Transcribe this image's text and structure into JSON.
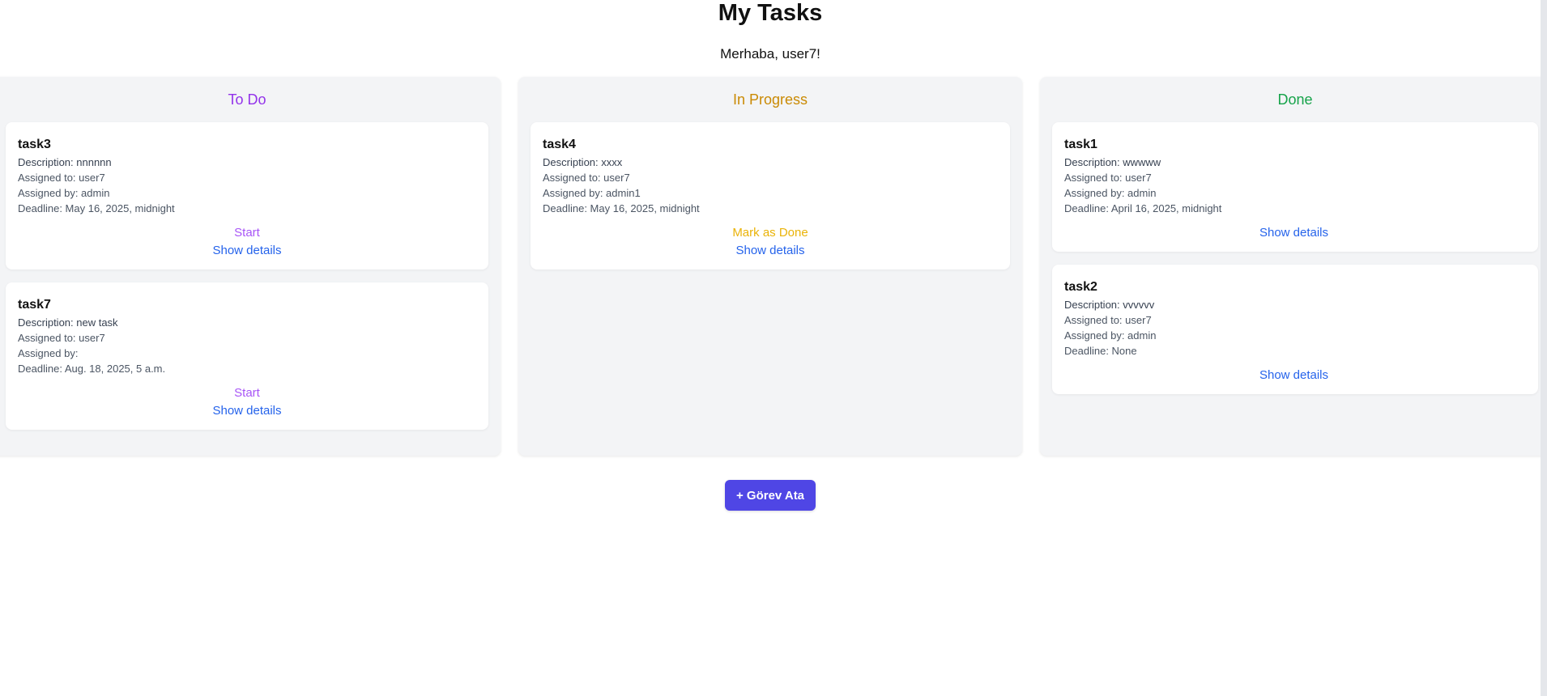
{
  "header": {
    "title": "My Tasks",
    "greeting": "Merhaba, user7!"
  },
  "columns": [
    {
      "title": "To Do",
      "color": "#9333ea",
      "tasks": [
        {
          "name": "task3",
          "description": "Description: nnnnnn",
          "assigned_to": "Assigned to: user7",
          "assigned_by": "Assigned by: admin",
          "deadline": "Deadline: May 16, 2025, midnight",
          "action": "Start",
          "details": "Show details"
        },
        {
          "name": "task7",
          "description": "Description: new task",
          "assigned_to": "Assigned to: user7",
          "assigned_by": "Assigned by:",
          "deadline": "Deadline: Aug. 18, 2025, 5 a.m.",
          "action": "Start",
          "details": "Show details"
        }
      ]
    },
    {
      "title": "In Progress",
      "color": "#ca8a04",
      "tasks": [
        {
          "name": "task4",
          "description": "Description: xxxx",
          "assigned_to": "Assigned to: user7",
          "assigned_by": "Assigned by: admin1",
          "deadline": "Deadline: May 16, 2025, midnight",
          "action": "Mark as Done",
          "details": "Show details"
        }
      ]
    },
    {
      "title": "Done",
      "color": "#16a34a",
      "tasks": [
        {
          "name": "task1",
          "description": "Description: wwwww",
          "assigned_to": "Assigned to: user7",
          "assigned_by": "Assigned by: admin",
          "deadline": "Deadline: April 16, 2025, midnight",
          "details": "Show details"
        },
        {
          "name": "task2",
          "description": "Description: vvvvvv",
          "assigned_to": "Assigned to: user7",
          "assigned_by": "Assigned by: admin",
          "deadline": "Deadline: None",
          "details": "Show details"
        }
      ]
    }
  ],
  "assign_button": {
    "label": "+ Görev Ata",
    "color": "#4f46e5"
  }
}
